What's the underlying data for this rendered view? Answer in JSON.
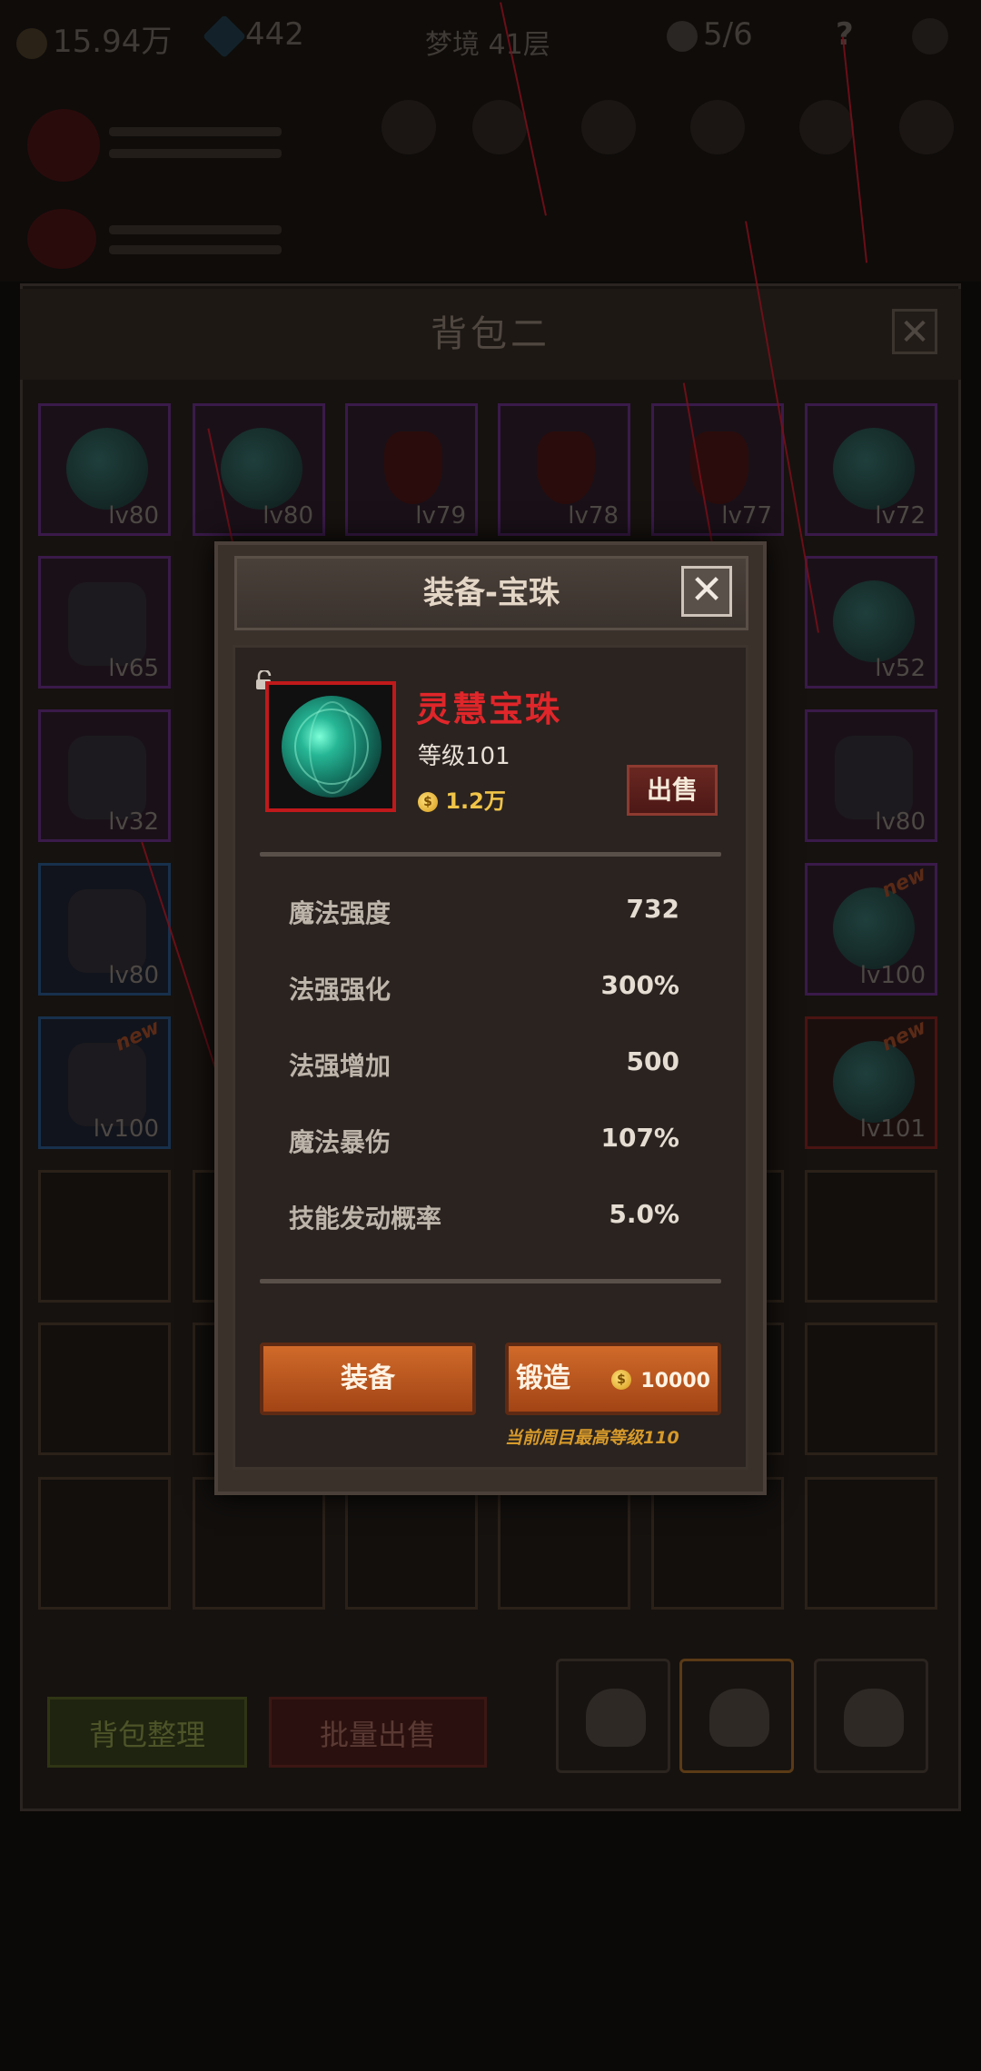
{
  "hud": {
    "gold": "15.94万",
    "gems": "442",
    "dream": "梦境 41层",
    "skull": "5/6",
    "help": "?"
  },
  "backpack": {
    "title": "背包二",
    "close": "✕",
    "grid": [
      {
        "lv": "lv80",
        "kind": "gem",
        "frame": "p"
      },
      {
        "lv": "lv80",
        "kind": "gem",
        "frame": "p"
      },
      {
        "lv": "lv79",
        "kind": "neck",
        "frame": "p"
      },
      {
        "lv": "lv78",
        "kind": "neck",
        "frame": "p"
      },
      {
        "lv": "lv77",
        "kind": "neck",
        "frame": "p"
      },
      {
        "lv": "lv72",
        "kind": "gem",
        "frame": "p"
      },
      {
        "lv": "lv65",
        "kind": "armor",
        "frame": "p"
      },
      {
        "lv": "lv52",
        "kind": "gem",
        "frame": "p"
      },
      {
        "lv": "lv32",
        "kind": "armor",
        "frame": "p"
      },
      {
        "lv": "lv80",
        "kind": "armor",
        "frame": "p"
      },
      {
        "lv": "lv80",
        "kind": "armor",
        "frame": "b"
      },
      {
        "lv": "lv100",
        "kind": "gem",
        "frame": "p",
        "new": "new"
      },
      {
        "lv": "lv100",
        "kind": "armor",
        "frame": "b",
        "new": "new"
      },
      {
        "lv": "lv101",
        "kind": "gem",
        "frame": "r",
        "new": "new"
      }
    ],
    "sort_label": "背包整理",
    "bulk_sell_label": "批量出售"
  },
  "modal": {
    "title": "装备-宝珠",
    "close": "✕",
    "item_name": "灵慧宝珠",
    "level_text": "等级101",
    "price": "1.2万",
    "coin_glyph": "$",
    "sell_label": "出售",
    "stats": [
      {
        "label": "魔法强度",
        "value": "732"
      },
      {
        "label": "法强强化",
        "value": "300%"
      },
      {
        "label": "法强增加",
        "value": "500"
      },
      {
        "label": "魔法暴伤",
        "value": "107%"
      },
      {
        "label": "技能发动概率",
        "value": "5.0%"
      }
    ],
    "equip_label": "装备",
    "forge_label": "锻造",
    "forge_cost": "10000",
    "note": "当前周目最高等级110"
  },
  "colors": {
    "item_name": "#e0262a",
    "button_orange": "#c45a22",
    "sell_red": "#5a1f1b",
    "note_gold": "#d79a2a"
  }
}
